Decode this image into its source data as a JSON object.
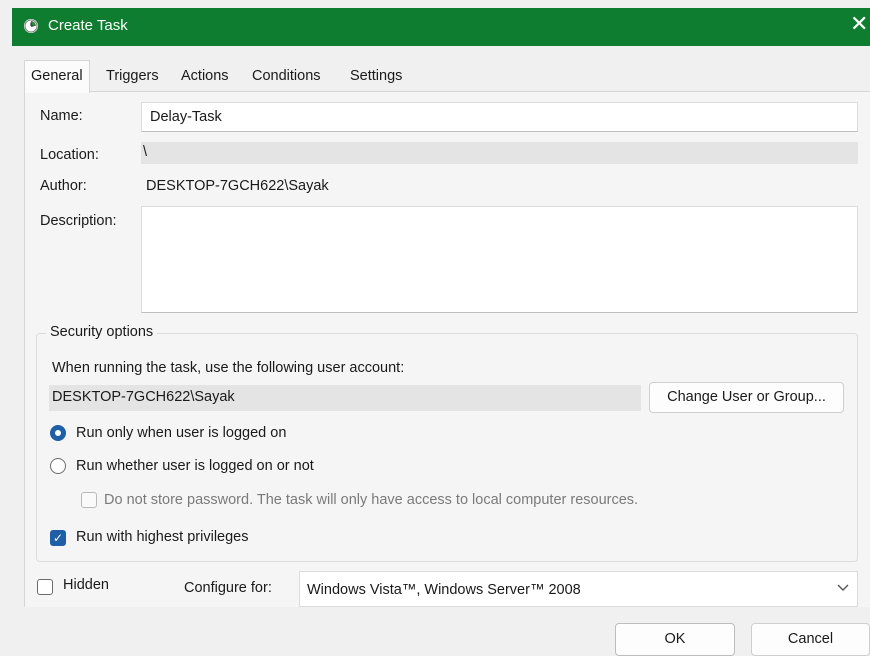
{
  "window": {
    "title": "Create Task",
    "close_glyph": "✕"
  },
  "tabs": [
    "General",
    "Triggers",
    "Actions",
    "Conditions",
    "Settings"
  ],
  "general": {
    "name_label": "Name:",
    "name_value": "Delay-Task",
    "location_label": "Location:",
    "location_value": "\\",
    "author_label": "Author:",
    "author_value": "DESKTOP-7GCH622\\Sayak",
    "description_label": "Description:",
    "description_value": ""
  },
  "security": {
    "legend": "Security options",
    "account_prompt": "When running the task, use the following user account:",
    "account_value": "DESKTOP-7GCH622\\Sayak",
    "change_button": "Change User or Group...",
    "radio_logged_on": "Run only when user is logged on",
    "radio_logged_on_selected": true,
    "radio_whether": "Run whether user is logged on or not",
    "radio_whether_selected": false,
    "no_store_password": "Do not store password.  The task will only have access to local computer resources.",
    "no_store_password_checked": false,
    "highest_privileges": "Run with highest privileges",
    "highest_privileges_checked": true
  },
  "footer": {
    "hidden_label": "Hidden",
    "hidden_checked": false,
    "configure_label": "Configure for:",
    "configure_value": "Windows Vista™, Windows Server™ 2008",
    "ok_button": "OK",
    "cancel_button": "Cancel"
  },
  "colors": {
    "titlebar": "#0f7d2f",
    "accent": "#1e5fa8"
  },
  "icons": {
    "window": "clock-icon",
    "close": "close-icon",
    "combo": "chevron-down-icon",
    "check": "check-mark-icon"
  }
}
